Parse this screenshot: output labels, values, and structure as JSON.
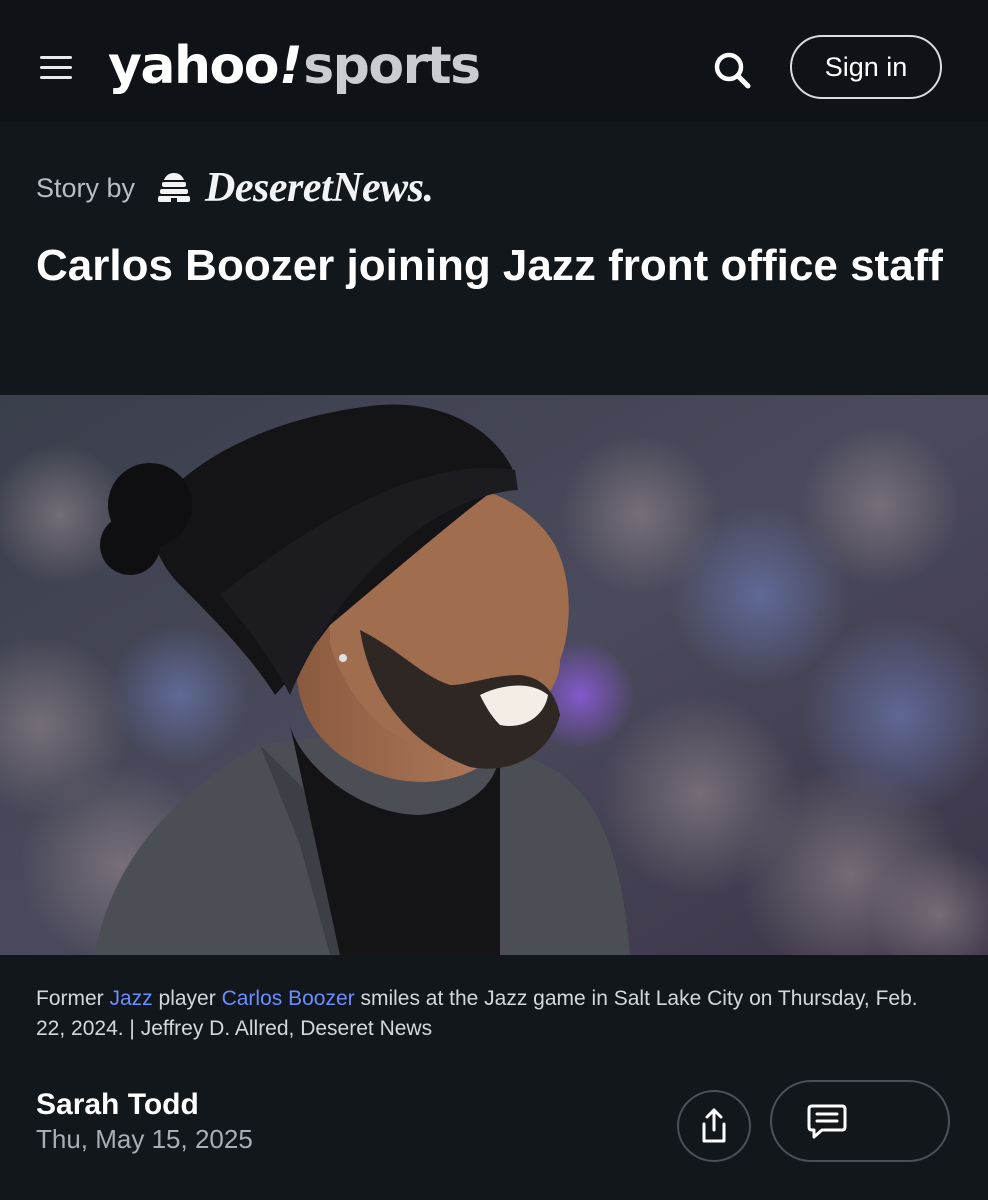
{
  "header": {
    "logo": {
      "yahoo": "yahoo",
      "bang": "!",
      "section": "sports"
    },
    "signin_label": "Sign in",
    "icons": [
      "menu-icon",
      "search-icon"
    ]
  },
  "article": {
    "story_by_label": "Story by",
    "source_name": "DeseretNews.",
    "headline": "Carlos Boozer joining Jazz front office staff",
    "caption": {
      "prefix": "Former ",
      "link1": "Jazz",
      "middle": " player ",
      "link2": "Carlos Boozer",
      "suffix": " smiles at the Jazz game in Salt Lake City on Thursday, Feb. 22, 2024. | Jeffrey D. Allred, Deseret News"
    },
    "author": "Sarah Todd",
    "date": "Thu, May 15, 2025"
  },
  "colors": {
    "background": "#12171b",
    "header_bg": "#0f1317",
    "link": "#6c8cff",
    "muted_text": "#a9aeb5"
  },
  "action_icons": [
    "share-icon",
    "comments-icon"
  ]
}
